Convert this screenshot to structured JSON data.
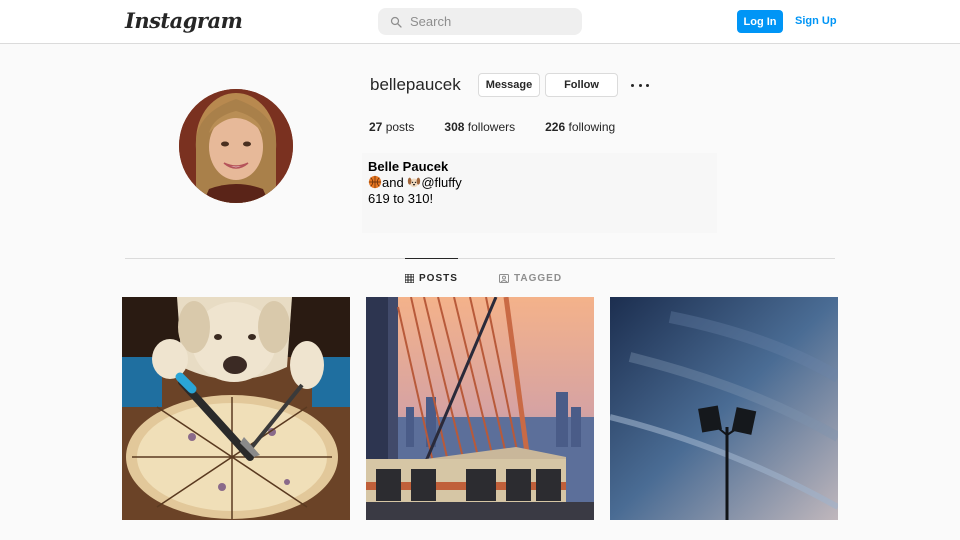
{
  "header": {
    "logo_text": "Instagram",
    "search": {
      "placeholder": "Search",
      "value": ""
    },
    "login_label": "Log In",
    "signup_label": "Sign Up"
  },
  "profile": {
    "username": "bellepaucek",
    "message_label": "Message",
    "follow_label": "Follow",
    "more_icon": "more-horizontal-icon",
    "stats": {
      "posts_count": "27",
      "posts_label": "posts",
      "followers_count": "308",
      "followers_label": "followers",
      "following_count": "226",
      "following_label": "following"
    },
    "full_name": "Belle Paucek",
    "bio": {
      "line1_text": "and ",
      "line1_mention": "@fluffy",
      "line2": "619 to 310!",
      "emojis": [
        "basketball-icon",
        "dog-face-icon"
      ]
    }
  },
  "tabs": [
    {
      "label": "POSTS",
      "icon": "grid-icon",
      "active": true
    },
    {
      "label": "TAGGED",
      "icon": "tagged-icon",
      "active": false
    }
  ],
  "posts": [
    {
      "subject": "dog-with-pizza"
    },
    {
      "subject": "bridge-and-train"
    },
    {
      "subject": "streetlight-and-sky"
    }
  ],
  "colors": {
    "accent": "#0095f6",
    "text": "#262626",
    "muted": "#8e8e8e",
    "border": "#dbdbdb",
    "background": "#fafafa"
  }
}
